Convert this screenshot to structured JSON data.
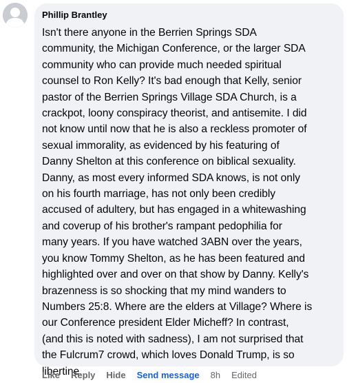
{
  "comment": {
    "author": "Phillip Brantley",
    "lines": [
      "Isn't there anyone in the Berrien Springs SDA",
      "community, the Michigan Conference, or the larger SDA",
      "community who can provide much needed spiritual",
      "counsel to Ron Kelly? It's bad enough that Kelly, senior",
      "pastor of the Berrien Springs Village SDA Church, is a",
      "crackpot, loony conspiracy theorist, and antisemite. I did",
      "not know until now that he is also a reckless promoter of",
      "sexual immorality, as evidenced by his featuring of",
      "Danny Shelton at this conference on biblical sexuality.",
      "Danny, as most every informed SDA knows, is not only",
      "on his fourth marriage, has not only been credibly",
      "accused of adultery, but has engaged in a whitewashing",
      "and coverup of his brother's rampant pedophilia for",
      "many years. If you have watched 3ABN over the years,",
      "you know Tommy Shelton, as he has been featured and",
      "highlighted over and over on that show by Danny. Kelly's",
      "brazenness is so shocking that my mind wanders to",
      "Numbers 25:8. Where are the elders at Village? Where is",
      "our Conference president Elder Micheff? In contrast,",
      "(and this is noted with sadness), I am not surprised that",
      "the Fulcrum7 crowd, which loves Donald Trump, is so",
      "libertine."
    ]
  },
  "actions": {
    "like": "Like",
    "reply": "Reply",
    "hide": "Hide",
    "send_message": "Send message",
    "time": "8h",
    "edited": "Edited"
  },
  "colors": {
    "bubble": "#f0f2f5",
    "text": "#050505",
    "muted": "#65676b",
    "link": "#1b5fcc"
  },
  "icons": {
    "avatar": "default-profile-silhouette-icon"
  }
}
